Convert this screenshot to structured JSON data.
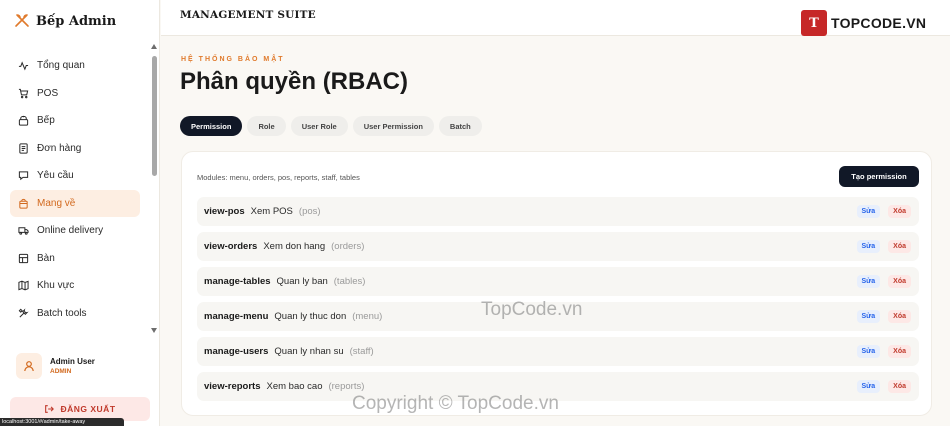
{
  "brand": {
    "name": "Bếp Admin",
    "icon": "utensils-cross-icon"
  },
  "sidebar": {
    "items": [
      {
        "label": "Tổng quan",
        "icon": "activity-icon",
        "active": false
      },
      {
        "label": "POS",
        "icon": "cart-icon",
        "active": false
      },
      {
        "label": "Bếp",
        "icon": "kitchen-icon",
        "active": false
      },
      {
        "label": "Đơn hàng",
        "icon": "receipt-icon",
        "active": false
      },
      {
        "label": "Yêu cầu",
        "icon": "message-icon",
        "active": false
      },
      {
        "label": "Mang về",
        "icon": "bag-icon",
        "active": true
      },
      {
        "label": "Online delivery",
        "icon": "truck-icon",
        "active": false
      },
      {
        "label": "Bàn",
        "icon": "table-icon",
        "active": false
      },
      {
        "label": "Khu vực",
        "icon": "map-icon",
        "active": false
      },
      {
        "label": "Batch tools",
        "icon": "tools-icon",
        "active": false
      }
    ]
  },
  "user": {
    "name": "Admin User",
    "role": "ADMIN"
  },
  "logout_label": "ĐĂNG XUẤT",
  "status_url": "localhost:3001/#/admin/take-away",
  "topbar": {
    "suite": "MANAGEMENT SUITE",
    "logo_mark": "T",
    "logo_text": "TOPCODE.VN"
  },
  "page": {
    "eyebrow": "HỆ THỐNG BẢO MẬT",
    "title": "Phân quyền (RBAC)"
  },
  "tabs": [
    {
      "label": "Permission",
      "active": true
    },
    {
      "label": "Role",
      "active": false
    },
    {
      "label": "User Role",
      "active": false
    },
    {
      "label": "User Permission",
      "active": false
    },
    {
      "label": "Batch",
      "active": false
    }
  ],
  "panel": {
    "modules_text": "Modules: menu, orders, pos, reports, staff, tables",
    "create_label": "Tạo permission",
    "edit_label": "Sửa",
    "delete_label": "Xóa",
    "rows": [
      {
        "key": "view-pos",
        "desc": "Xem POS",
        "module": "(pos)"
      },
      {
        "key": "view-orders",
        "desc": "Xem don hang",
        "module": "(orders)"
      },
      {
        "key": "manage-tables",
        "desc": "Quan ly ban",
        "module": "(tables)"
      },
      {
        "key": "manage-menu",
        "desc": "Quan ly thuc don",
        "module": "(menu)"
      },
      {
        "key": "manage-users",
        "desc": "Quan ly nhan su",
        "module": "(staff)"
      },
      {
        "key": "view-reports",
        "desc": "Xem bao cao",
        "module": "(reports)"
      }
    ]
  },
  "watermarks": {
    "center": "TopCode.vn",
    "bottom": "Copyright © TopCode.vn"
  },
  "colors": {
    "accent": "#e07a2c",
    "dark": "#111827",
    "danger": "#c0392b",
    "link": "#2563eb"
  }
}
